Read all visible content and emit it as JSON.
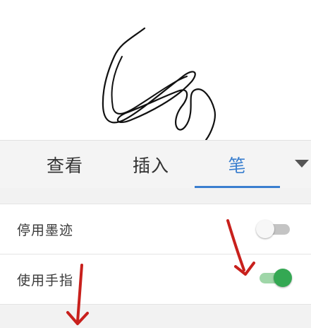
{
  "tabs": [
    {
      "label": "查看",
      "active": false
    },
    {
      "label": "插入",
      "active": false
    },
    {
      "label": "笔",
      "active": true
    }
  ],
  "settings": {
    "disable_ink": {
      "label": "停用墨迹",
      "enabled": false
    },
    "use_finger": {
      "label": "使用手指",
      "enabled": true
    }
  },
  "colors": {
    "accent": "#3a7fcf",
    "toggle_on": "#34a853",
    "toggle_off": "#c4c4c4",
    "annotation_arrow": "#c8201c",
    "ink_stroke": "#111111"
  },
  "icons": {
    "tab_menu": "triangle-down-icon",
    "annotation": "red-arrow-icon"
  }
}
